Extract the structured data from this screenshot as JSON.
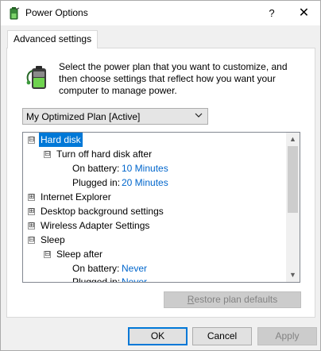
{
  "window": {
    "title": "Power Options",
    "help_glyph": "?",
    "close_glyph": "✕"
  },
  "tabs": [
    {
      "label": "Advanced settings"
    }
  ],
  "intro": {
    "text": "Select the power plan that you want to customize, and then choose settings that reflect how you want your computer to manage power."
  },
  "plan_select": {
    "value": "My Optimized Plan [Active]"
  },
  "tree": {
    "items": [
      {
        "label": "Hard disk",
        "expander": "⊟",
        "selected": true
      },
      {
        "label": "Turn off hard disk after",
        "expander": "⊟"
      },
      {
        "label": "On battery:",
        "value": "10 Minutes"
      },
      {
        "label": "Plugged in:",
        "value": "20 Minutes"
      },
      {
        "label": "Internet Explorer",
        "expander": "⊞"
      },
      {
        "label": "Desktop background settings",
        "expander": "⊞"
      },
      {
        "label": "Wireless Adapter Settings",
        "expander": "⊞"
      },
      {
        "label": "Sleep",
        "expander": "⊟"
      },
      {
        "label": "Sleep after",
        "expander": "⊟"
      },
      {
        "label": "On battery:",
        "value": "Never"
      },
      {
        "label": "Plugged in:",
        "value": "Never"
      }
    ]
  },
  "scrollbar": {
    "up_glyph": "▲",
    "down_glyph": "▼"
  },
  "restore_button": {
    "label_prefix": "",
    "label_underlined": "R",
    "label_rest": "estore plan defaults"
  },
  "buttons": {
    "ok": "OK",
    "cancel": "Cancel",
    "apply": "Apply"
  },
  "colors": {
    "accent": "#0078d7",
    "link": "#0066cc"
  }
}
